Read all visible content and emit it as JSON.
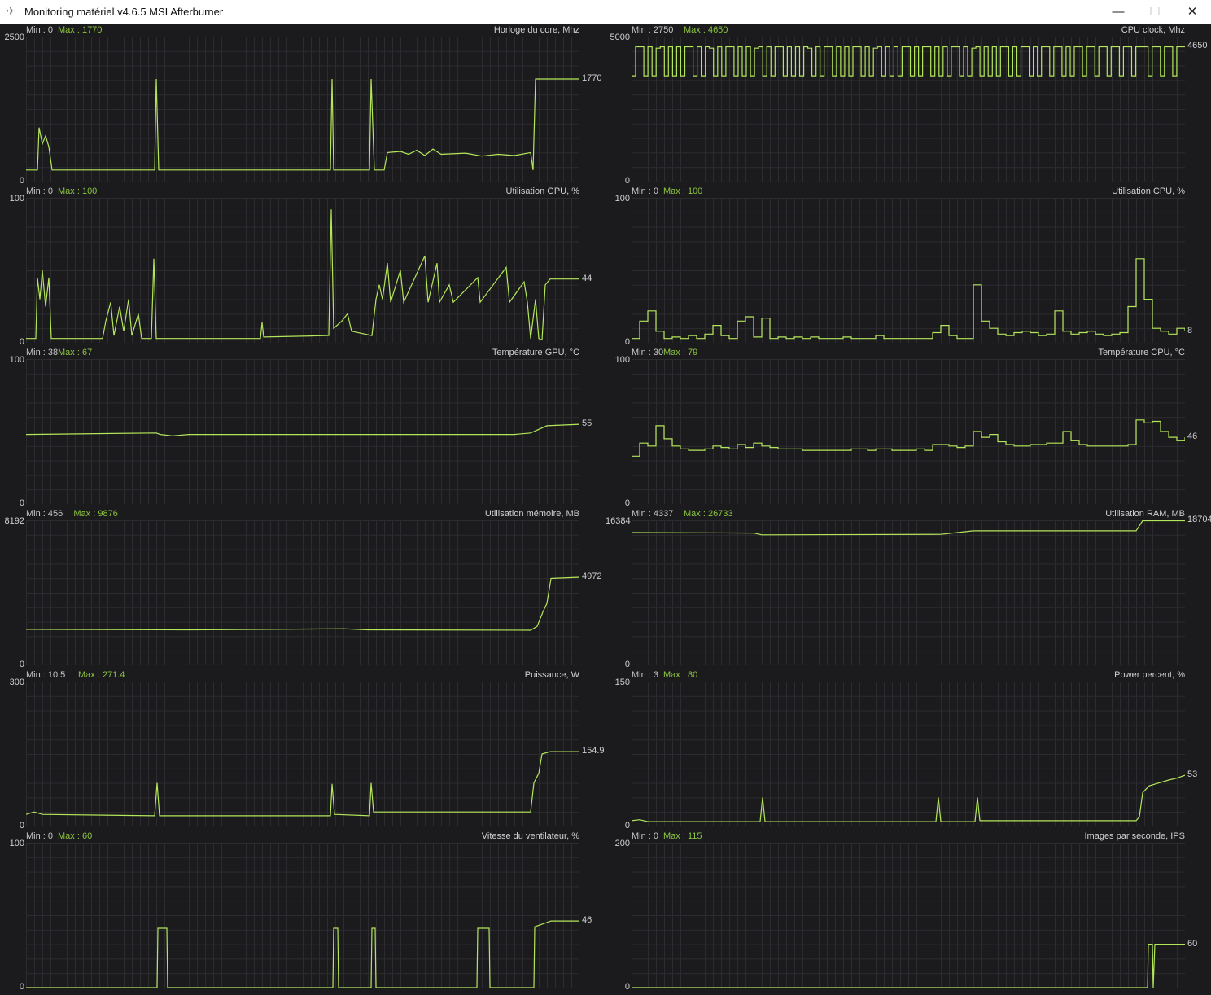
{
  "window": {
    "title": "Monitoring matériel  v4.6.5 MSI Afterburner",
    "minimize_icon": "minimize-icon",
    "maximize_icon": "maximize-icon",
    "close_icon": "close-icon"
  },
  "colors": {
    "line": "#b4e65a",
    "max_text": "#8cc63f",
    "background": "#1b1b1e",
    "grid": "#2c2c30"
  },
  "chart_data": [
    {
      "type": "line",
      "title": "Horloge du core, Mhz",
      "min_label": "Min : 0",
      "max_label": "Max : 1770",
      "ylim": [
        0,
        2500
      ],
      "ytop": "2500",
      "ybottom": "0",
      "current": "1770",
      "xlim": [
        0,
        680
      ],
      "points": [
        [
          0,
          200
        ],
        [
          14,
          200
        ],
        [
          16,
          930
        ],
        [
          20,
          650
        ],
        [
          24,
          790
        ],
        [
          28,
          600
        ],
        [
          32,
          200
        ],
        [
          158,
          200
        ],
        [
          160,
          1770
        ],
        [
          163,
          200
        ],
        [
          374,
          200
        ],
        [
          376,
          1770
        ],
        [
          378,
          200
        ],
        [
          422,
          200
        ],
        [
          424,
          1770
        ],
        [
          428,
          200
        ],
        [
          440,
          200
        ],
        [
          444,
          500
        ],
        [
          460,
          520
        ],
        [
          470,
          470
        ],
        [
          480,
          540
        ],
        [
          490,
          450
        ],
        [
          500,
          560
        ],
        [
          510,
          470
        ],
        [
          540,
          490
        ],
        [
          560,
          440
        ],
        [
          580,
          470
        ],
        [
          600,
          450
        ],
        [
          620,
          500
        ],
        [
          623,
          200
        ],
        [
          626,
          1770
        ],
        [
          680,
          1770
        ]
      ]
    },
    {
      "type": "line",
      "title": "CPU clock, Mhz",
      "min_label": "Min : 2750",
      "max_label": "Max : 4650",
      "ylim": [
        0,
        5000
      ],
      "ytop": "5000",
      "ybottom": "0",
      "current": "4650",
      "xlim": [
        0,
        680
      ],
      "values": [
        3650,
        4650,
        4650,
        3650,
        4650,
        3650,
        4600,
        4650,
        3650,
        4650,
        3650,
        4650,
        3650,
        4650,
        4650,
        3650,
        4650,
        3650,
        4650,
        4600,
        3650,
        4650,
        3650,
        4650,
        4650,
        3650,
        4650,
        3650,
        4650,
        3650,
        4600,
        4650,
        3650,
        4650,
        3650,
        4650,
        4650,
        3650,
        4650,
        3650,
        4650,
        3650,
        4650,
        4600,
        3650,
        4650,
        3650,
        4650,
        4650,
        3650,
        4650,
        3650,
        4650,
        3650,
        4650,
        4650,
        3650,
        4650,
        3650,
        4600,
        4650,
        3650,
        4650,
        3650,
        4650,
        3650,
        4650,
        4650,
        3650,
        4650,
        3650,
        4650,
        4650,
        3650,
        4650,
        3650,
        4650,
        3650,
        4650,
        4650,
        3650,
        4650,
        3650,
        4600,
        4650,
        3650,
        4650,
        3650,
        4650,
        3650,
        4650,
        4650,
        3650,
        4650,
        3650,
        4650,
        4650,
        3650,
        4650,
        3650,
        4650,
        4650,
        3650,
        4650,
        4650,
        3650,
        4650,
        3650,
        4650,
        4650,
        3650,
        4650,
        4650,
        3650,
        4650,
        4650,
        3650,
        4650,
        4650,
        3650,
        4650,
        4650,
        3650,
        4650,
        4650,
        4650,
        3650,
        4650,
        4650,
        3650,
        4650,
        4650,
        3650,
        4650,
        4650,
        4650
      ]
    },
    {
      "type": "line",
      "title": "Utilisation GPU, %",
      "min_label": "Min : 0",
      "max_label": "Max : 100",
      "ylim": [
        0,
        100
      ],
      "ytop": "100",
      "ybottom": "0",
      "current": "44",
      "xlim": [
        0,
        680
      ],
      "points": [
        [
          0,
          3
        ],
        [
          12,
          3
        ],
        [
          14,
          45
        ],
        [
          17,
          30
        ],
        [
          20,
          50
        ],
        [
          24,
          25
        ],
        [
          28,
          45
        ],
        [
          31,
          3
        ],
        [
          94,
          3
        ],
        [
          98,
          15
        ],
        [
          104,
          28
        ],
        [
          108,
          5
        ],
        [
          115,
          25
        ],
        [
          120,
          8
        ],
        [
          126,
          30
        ],
        [
          130,
          5
        ],
        [
          138,
          20
        ],
        [
          142,
          3
        ],
        [
          154,
          3
        ],
        [
          157,
          58
        ],
        [
          160,
          3
        ],
        [
          288,
          3
        ],
        [
          290,
          14
        ],
        [
          292,
          4
        ],
        [
          372,
          5
        ],
        [
          375,
          92
        ],
        [
          378,
          10
        ],
        [
          388,
          15
        ],
        [
          395,
          20
        ],
        [
          400,
          8
        ],
        [
          425,
          5
        ],
        [
          430,
          30
        ],
        [
          434,
          40
        ],
        [
          438,
          30
        ],
        [
          444,
          55
        ],
        [
          448,
          28
        ],
        [
          460,
          50
        ],
        [
          464,
          28
        ],
        [
          490,
          60
        ],
        [
          494,
          28
        ],
        [
          505,
          55
        ],
        [
          508,
          28
        ],
        [
          520,
          40
        ],
        [
          525,
          28
        ],
        [
          555,
          45
        ],
        [
          558,
          28
        ],
        [
          590,
          52
        ],
        [
          594,
          28
        ],
        [
          612,
          42
        ],
        [
          616,
          28
        ],
        [
          620,
          3
        ],
        [
          626,
          30
        ],
        [
          630,
          3
        ],
        [
          634,
          2
        ],
        [
          638,
          40
        ],
        [
          644,
          44
        ],
        [
          680,
          44
        ]
      ]
    },
    {
      "type": "line",
      "title": "Utilisation CPU, %",
      "min_label": "Min : 0",
      "max_label": "Max : 100",
      "ylim": [
        0,
        100
      ],
      "ytop": "100",
      "ybottom": "0",
      "current": "8",
      "xlim": [
        0,
        680
      ],
      "values": [
        3,
        15,
        22,
        8,
        3,
        4,
        3,
        5,
        3,
        6,
        12,
        5,
        3,
        15,
        18,
        4,
        17,
        3,
        4,
        3,
        4,
        3,
        4,
        3,
        3,
        3,
        4,
        3,
        3,
        3,
        5,
        3,
        3,
        3,
        3,
        3,
        3,
        7,
        12,
        5,
        3,
        3,
        40,
        15,
        10,
        6,
        5,
        7,
        8,
        7,
        5,
        6,
        22,
        8,
        6,
        7,
        8,
        6,
        5,
        6,
        7,
        25,
        58,
        30,
        10,
        8,
        6,
        10,
        8
      ]
    },
    {
      "type": "line",
      "title": "Température GPU, °C",
      "min_label": "Min : 38",
      "max_label": "Max : 67",
      "ylim": [
        0,
        100
      ],
      "ytop": "100",
      "ybottom": "0",
      "current": "55",
      "xlim": [
        0,
        680
      ],
      "points": [
        [
          0,
          48
        ],
        [
          160,
          49
        ],
        [
          165,
          48
        ],
        [
          180,
          47
        ],
        [
          200,
          48
        ],
        [
          375,
          48
        ],
        [
          420,
          48
        ],
        [
          600,
          48
        ],
        [
          620,
          49
        ],
        [
          640,
          54
        ],
        [
          680,
          55
        ]
      ]
    },
    {
      "type": "line",
      "title": "Température CPU, °C",
      "min_label": "Min : 30",
      "max_label": "Max : 79",
      "ylim": [
        0,
        100
      ],
      "ytop": "100",
      "ybottom": "0",
      "current": "46",
      "xlim": [
        0,
        680
      ],
      "values": [
        33,
        42,
        40,
        54,
        45,
        40,
        38,
        37,
        37,
        38,
        40,
        39,
        38,
        41,
        39,
        42,
        40,
        39,
        38,
        38,
        38,
        37,
        37,
        37,
        37,
        37,
        37,
        38,
        38,
        37,
        38,
        38,
        37,
        37,
        37,
        38,
        37,
        41,
        41,
        40,
        39,
        40,
        50,
        46,
        48,
        43,
        41,
        40,
        40,
        41,
        41,
        42,
        42,
        50,
        44,
        41,
        40,
        40,
        40,
        40,
        40,
        41,
        58,
        56,
        57,
        50,
        46,
        44,
        46
      ]
    },
    {
      "type": "line",
      "title": "Utilisation mémoire, MB",
      "min_label": "Min : 456",
      "max_label": "Max : 9876",
      "ylim": [
        0,
        8192
      ],
      "ytop": "8192",
      "ybottom": "0",
      "current": "4972",
      "xlim": [
        0,
        680
      ],
      "points": [
        [
          0,
          2030
        ],
        [
          200,
          2000
        ],
        [
          390,
          2060
        ],
        [
          420,
          2000
        ],
        [
          620,
          1980
        ],
        [
          628,
          2200
        ],
        [
          635,
          3000
        ],
        [
          640,
          3500
        ],
        [
          645,
          4900
        ],
        [
          680,
          4972
        ]
      ]
    },
    {
      "type": "line",
      "title": "Utilisation RAM, MB",
      "min_label": "Min : 4337",
      "max_label": "Max : 26733",
      "ylim": [
        0,
        16384
      ],
      "ytop": "16384",
      "ybottom": "0",
      "current": "18704",
      "xlim": [
        0,
        680
      ],
      "points": [
        [
          0,
          15000
        ],
        [
          150,
          14950
        ],
        [
          160,
          14750
        ],
        [
          380,
          14800
        ],
        [
          420,
          15200
        ],
        [
          620,
          15200
        ],
        [
          628,
          16500
        ],
        [
          632,
          18704
        ],
        [
          680,
          18704
        ]
      ]
    },
    {
      "type": "line",
      "title": "Puissance, W",
      "min_label": "Min : 10.5",
      "max_label": "Max : 271.4",
      "ylim": [
        0,
        300
      ],
      "ytop": "300",
      "ybottom": "0",
      "current": "154.9",
      "xlim": [
        0,
        680
      ],
      "points": [
        [
          0,
          25
        ],
        [
          10,
          30
        ],
        [
          20,
          25
        ],
        [
          158,
          22
        ],
        [
          161,
          90
        ],
        [
          164,
          22
        ],
        [
          374,
          22
        ],
        [
          376,
          88
        ],
        [
          379,
          25
        ],
        [
          422,
          22
        ],
        [
          424,
          90
        ],
        [
          427,
          30
        ],
        [
          620,
          30
        ],
        [
          624,
          90
        ],
        [
          630,
          110
        ],
        [
          634,
          150
        ],
        [
          644,
          154.9
        ],
        [
          680,
          154.9
        ]
      ]
    },
    {
      "type": "line",
      "title": "Power percent, %",
      "min_label": "Min : 3",
      "max_label": "Max : 80",
      "ylim": [
        0,
        150
      ],
      "ytop": "150",
      "ybottom": "0",
      "current": "53",
      "xlim": [
        0,
        680
      ],
      "points": [
        [
          0,
          6
        ],
        [
          10,
          7
        ],
        [
          20,
          5
        ],
        [
          158,
          5
        ],
        [
          161,
          30
        ],
        [
          164,
          5
        ],
        [
          374,
          5
        ],
        [
          377,
          30
        ],
        [
          380,
          5
        ],
        [
          422,
          5
        ],
        [
          425,
          30
        ],
        [
          428,
          6
        ],
        [
          620,
          6
        ],
        [
          624,
          10
        ],
        [
          628,
          35
        ],
        [
          636,
          42
        ],
        [
          648,
          45
        ],
        [
          660,
          48
        ],
        [
          670,
          50
        ],
        [
          680,
          53
        ]
      ]
    },
    {
      "type": "line",
      "title": "Vitesse du ventilateur, %",
      "min_label": "Min : 0",
      "max_label": "Max : 60",
      "ylim": [
        0,
        100
      ],
      "ytop": "100",
      "ybottom": "0",
      "current": "46",
      "xlim": [
        0,
        680
      ],
      "points": [
        [
          0,
          0
        ],
        [
          161,
          0
        ],
        [
          162,
          41
        ],
        [
          173,
          41
        ],
        [
          174,
          0
        ],
        [
          377,
          0
        ],
        [
          378,
          41
        ],
        [
          383,
          41
        ],
        [
          384,
          0
        ],
        [
          424,
          0
        ],
        [
          425,
          41
        ],
        [
          429,
          41
        ],
        [
          430,
          0
        ],
        [
          554,
          0
        ],
        [
          555,
          41
        ],
        [
          569,
          41
        ],
        [
          570,
          0
        ],
        [
          624,
          0
        ],
        [
          625,
          42
        ],
        [
          635,
          44
        ],
        [
          645,
          46
        ],
        [
          680,
          46
        ]
      ]
    },
    {
      "type": "line",
      "title": "Images par seconde, IPS",
      "min_label": "Min : 0",
      "max_label": "Max : 115",
      "ylim": [
        0,
        200
      ],
      "ytop": "200",
      "ybottom": "0",
      "current": "60",
      "xlim": [
        0,
        680
      ],
      "points": [
        [
          0,
          0
        ],
        [
          634,
          0
        ],
        [
          635,
          60
        ],
        [
          640,
          60
        ],
        [
          641,
          0
        ],
        [
          643,
          60
        ],
        [
          680,
          60
        ]
      ]
    }
  ]
}
